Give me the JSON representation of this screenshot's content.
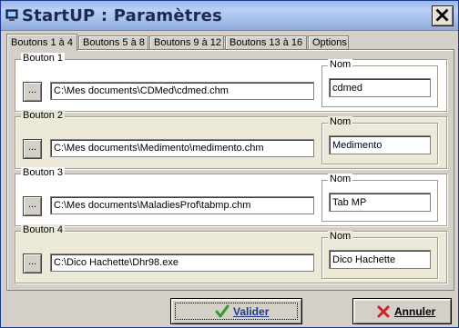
{
  "window": {
    "title": "StartUP : Paramètres",
    "close_label": "✕"
  },
  "tabs": [
    {
      "label": "Boutons 1 à 4",
      "active": true
    },
    {
      "label": "Boutons 5 à 8",
      "active": false
    },
    {
      "label": "Boutons 9 à 12",
      "active": false
    },
    {
      "label": "Boutons 13 à 16",
      "active": false
    },
    {
      "label": "Options",
      "active": false
    }
  ],
  "buttons_groups": [
    {
      "title": "Bouton 1",
      "browse_label": "...",
      "path": "C:\\Mes documents\\CDMed\\cdmed.chm",
      "nom_label": "Nom",
      "nom": "cdmed",
      "background": "white"
    },
    {
      "title": "Bouton 2",
      "browse_label": "...",
      "path": "C:\\Mes documents\\Medimento\\medimento.chm",
      "nom_label": "Nom",
      "nom": "Medimento",
      "background": "cream"
    },
    {
      "title": "Bouton 3",
      "browse_label": "...",
      "path": "C:\\Mes documents\\MaladiesProf\\tabmp.chm",
      "nom_label": "Nom",
      "nom": "Tab MP",
      "background": "white"
    },
    {
      "title": "Bouton 4",
      "browse_label": "...",
      "path": "C:\\Dico Hachette\\Dhr98.exe",
      "nom_label": "Nom",
      "nom": "Dico Hachette",
      "background": "cream"
    }
  ],
  "footer": {
    "validate_label": "Valider",
    "cancel_label": "Annuler"
  },
  "colors": {
    "titlebar": "#a9c2ee",
    "dialog": "#d4d0c8",
    "validate_text": "#1e3a8a",
    "check_green": "#2e9d2e",
    "cancel_red": "#cc2222"
  }
}
